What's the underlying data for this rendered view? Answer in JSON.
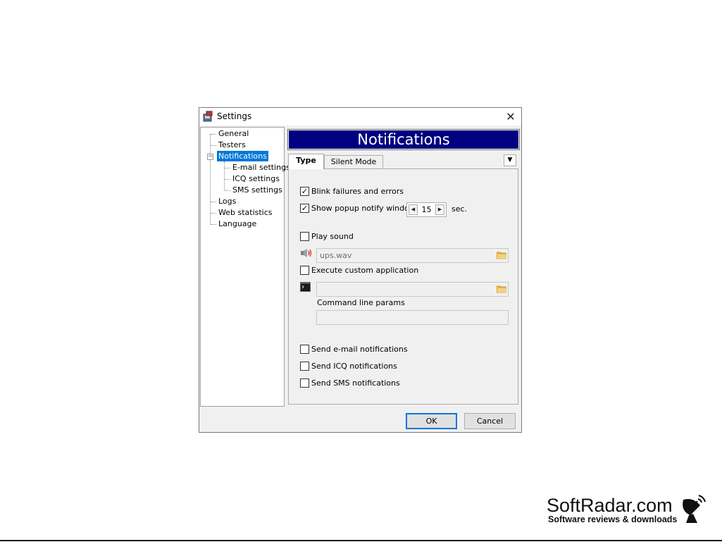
{
  "window": {
    "title": "Settings"
  },
  "tree": {
    "items": [
      {
        "label": "General",
        "level": 0
      },
      {
        "label": "Testers",
        "level": 0
      },
      {
        "label": "Notifications",
        "level": 0,
        "selected": true,
        "expanded": true
      },
      {
        "label": "E-mail settings",
        "level": 1
      },
      {
        "label": "ICQ settings",
        "level": 1
      },
      {
        "label": "SMS settings",
        "level": 1
      },
      {
        "label": "Logs",
        "level": 0
      },
      {
        "label": "Web statistics",
        "level": 0
      },
      {
        "label": "Language",
        "level": 0
      }
    ]
  },
  "panel": {
    "title": "Notifications"
  },
  "tabs": [
    {
      "label": "Type",
      "active": true
    },
    {
      "label": "Silent Mode",
      "active": false
    }
  ],
  "options": {
    "blink": {
      "label": "Blink failures and errors",
      "checked": true
    },
    "popup": {
      "label": "Show popup notify window",
      "checked": true,
      "seconds": "15",
      "unit": "sec."
    },
    "sound": {
      "label": "Play sound",
      "checked": false,
      "file": "ups.wav"
    },
    "custom_app": {
      "label": "Execute custom application",
      "checked": false,
      "path": "",
      "params_label": "Command line params",
      "params": ""
    },
    "email": {
      "label": "Send e-mail notifications",
      "checked": false
    },
    "icq": {
      "label": "Send ICQ notifications",
      "checked": false
    },
    "sms": {
      "label": "Send SMS notifications",
      "checked": false
    }
  },
  "buttons": {
    "ok": "OK",
    "cancel": "Cancel"
  },
  "watermark": {
    "title": "SoftRadar.com",
    "subtitle": "Software reviews & downloads"
  },
  "colors": {
    "banner": "#000080",
    "selection": "#0078d7"
  }
}
